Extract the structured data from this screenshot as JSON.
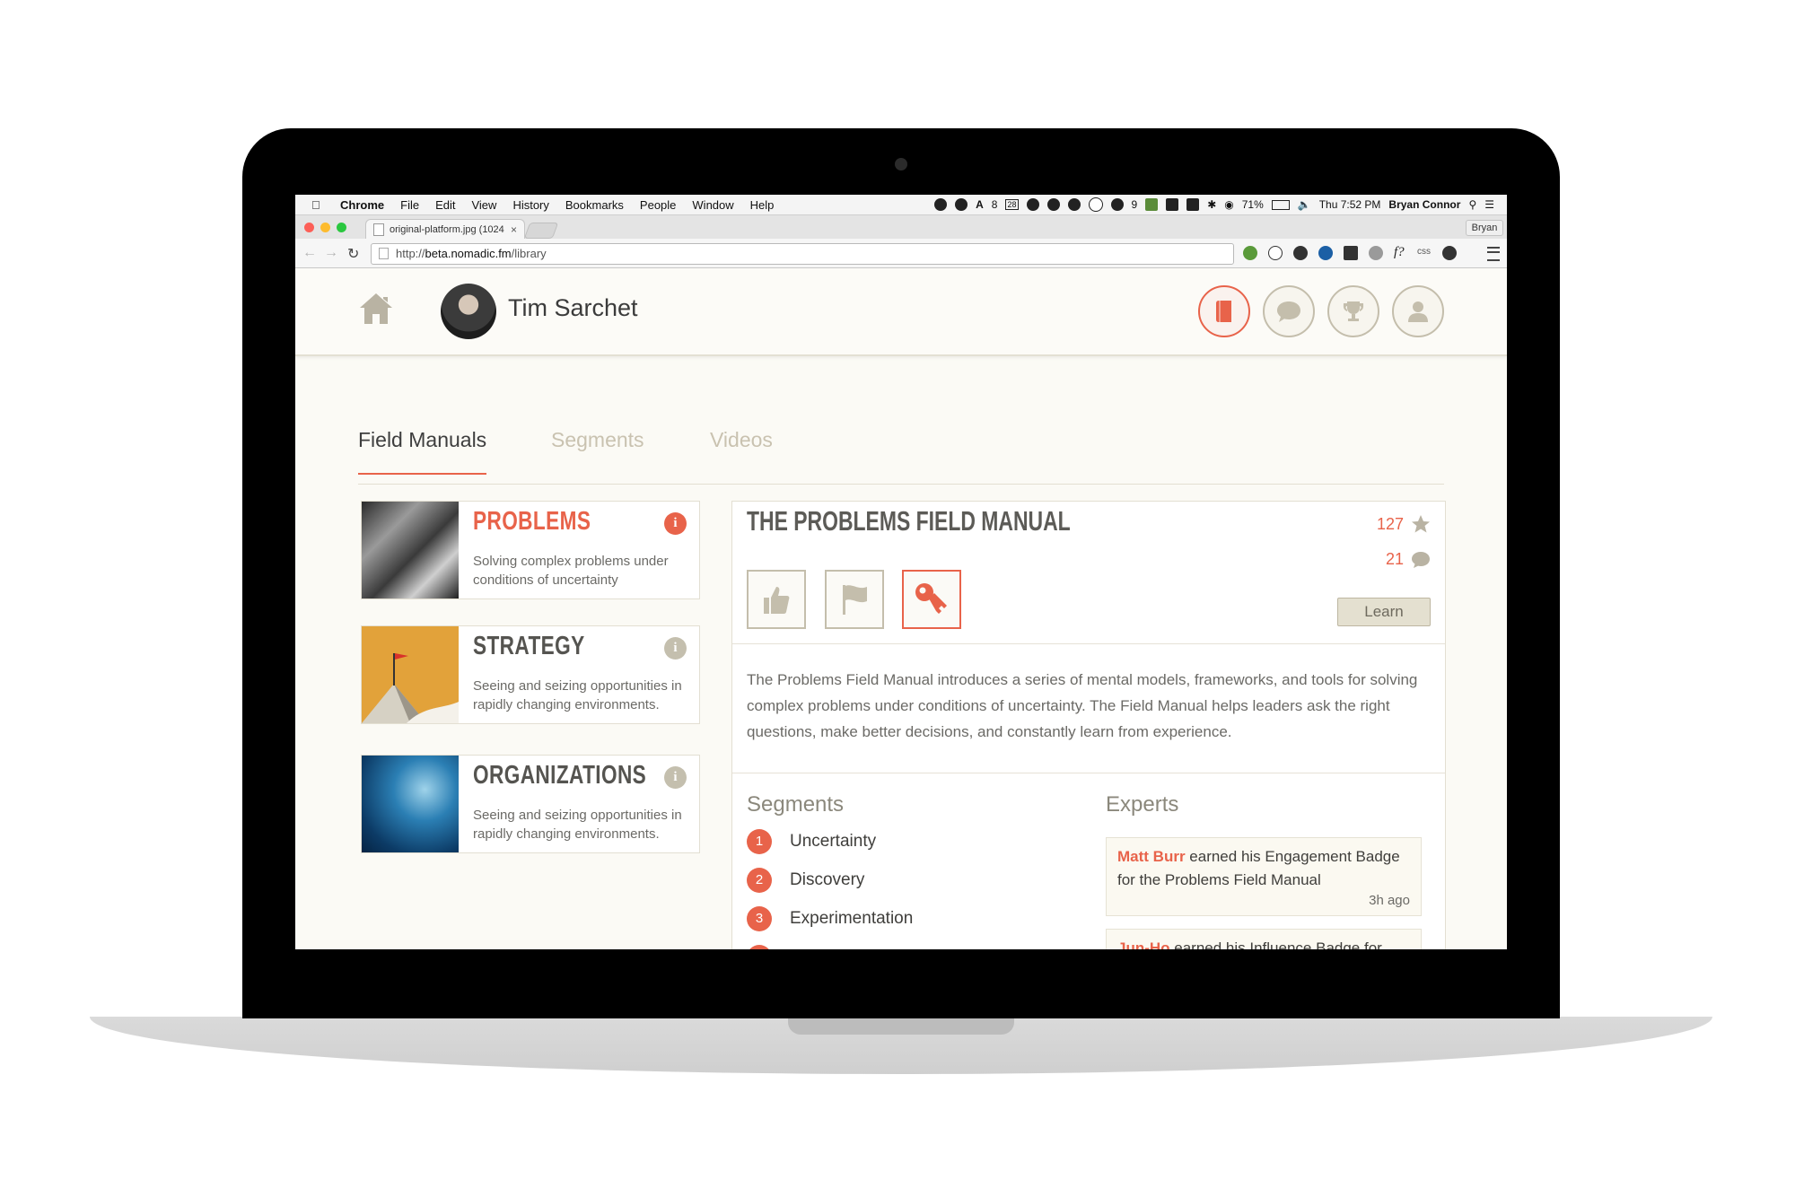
{
  "menubar": {
    "app": "Chrome",
    "items": [
      "File",
      "Edit",
      "View",
      "History",
      "Bookmarks",
      "People",
      "Window",
      "Help"
    ],
    "status_badge_1": "8",
    "status_badge_2": "28",
    "status_badge_3": "9",
    "battery": "71%",
    "clock": "Thu 7:52 PM",
    "user": "Bryan Connor"
  },
  "browser": {
    "tab_title": "original-platform.jpg (1024",
    "profile": "Bryan",
    "url_prefix": "http://",
    "url_host": "beta.nomadic.fm",
    "url_path": "/library",
    "ext_css": "css"
  },
  "header": {
    "user_name": "Tim Sarchet"
  },
  "tabs": [
    "Field Manuals",
    "Segments",
    "Videos"
  ],
  "manuals": [
    {
      "title": "PROBLEMS",
      "desc": "Solving complex problems under conditions of uncertainty",
      "color": "#e8634a"
    },
    {
      "title": "STRATEGY",
      "desc": "Seeing and seizing opportunities in rapidly changing environments.",
      "color": "#555450"
    },
    {
      "title": "ORGANIZATIONS",
      "desc": "Seeing and seizing opportunities in rapidly changing environments.",
      "color": "#555450"
    }
  ],
  "detail": {
    "title": "THE PROBLEMS FIELD MANUAL",
    "stars": "127",
    "comments": "21",
    "learn": "Learn",
    "description": "The Problems Field Manual introduces a series of mental models, frameworks, and tools for solving complex problems under conditions of uncertainty. The Field Manual helps leaders ask the right questions, make better decisions, and constantly learn from experience.",
    "segments_heading": "Segments",
    "segments": [
      {
        "n": "1",
        "label": "Uncertainty"
      },
      {
        "n": "2",
        "label": "Discovery"
      },
      {
        "n": "3",
        "label": "Experimentation"
      }
    ],
    "experts_heading": "Experts",
    "experts": [
      {
        "who": "Matt Burr",
        "text": " earned his Engagement Badge for the Problems Field Manual",
        "ago": "3h ago"
      },
      {
        "who": "Jun-Ho",
        "text": " earned his Influence Badge for",
        "ago": ""
      }
    ]
  },
  "colors": {
    "accent": "#e8634a",
    "muted": "#c4beac",
    "page": "#fbfaf5"
  }
}
